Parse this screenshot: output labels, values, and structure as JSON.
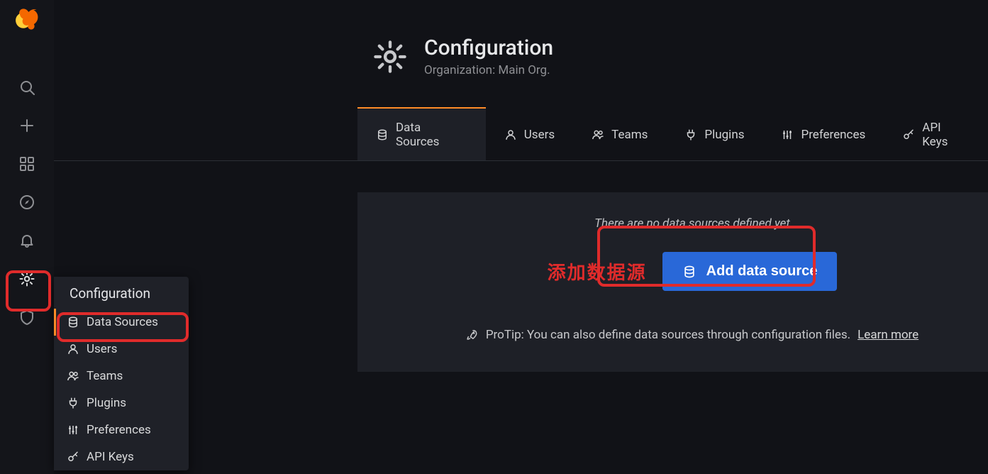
{
  "page": {
    "title": "Configuration",
    "subtitle": "Organization: Main Org."
  },
  "sidenav": {
    "submenu_title": "Configuration",
    "items": [
      {
        "label": "Data Sources"
      },
      {
        "label": "Users"
      },
      {
        "label": "Teams"
      },
      {
        "label": "Plugins"
      },
      {
        "label": "Preferences"
      },
      {
        "label": "API Keys"
      }
    ]
  },
  "tabs": [
    {
      "label": "Data Sources"
    },
    {
      "label": "Users"
    },
    {
      "label": "Teams"
    },
    {
      "label": "Plugins"
    },
    {
      "label": "Preferences"
    },
    {
      "label": "API Keys"
    }
  ],
  "content": {
    "empty_msg": "There are no data sources defined yet",
    "add_button": "Add data source",
    "protip_prefix": "ProTip: You can also define data sources through configuration files. ",
    "protip_link": "Learn more"
  },
  "annotation": {
    "cn_label": "添加数据源"
  }
}
